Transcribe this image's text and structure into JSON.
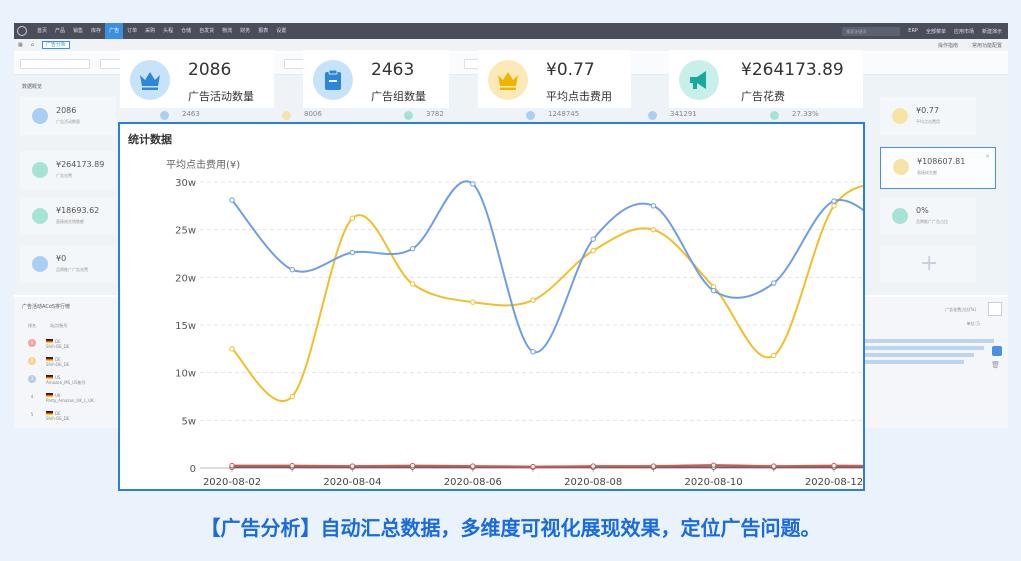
{
  "app": {
    "nav_items": [
      "首页",
      "产品",
      "销售",
      "库存",
      "广告",
      "订单",
      "采购",
      "头程",
      "仓储",
      "自发货",
      "物流",
      "财务",
      "报表",
      "设置"
    ],
    "active_nav": "广告",
    "search_placeholder": "搜索关键词",
    "nav_right": [
      "ERP",
      "全部菜单",
      "应用市场",
      "新建演示"
    ],
    "tab_label": "广告分析",
    "tab_right": [
      "操作指南",
      "常用功能配置"
    ]
  },
  "dashboard": {
    "section_title": "数据概览",
    "cards": [
      {
        "value": "2086",
        "label": "广告活动数量",
        "icon": "crown-icon",
        "color": "#a9cff5"
      },
      {
        "value": "¥264173.89",
        "label": "广告花费",
        "icon": "megaphone-icon",
        "color": "#a6e3d6"
      },
      {
        "value": "¥18693.62",
        "label": "直接成交销售额",
        "icon": "pie-icon",
        "color": "#a6e3d6"
      },
      {
        "value": "¥0",
        "label": "品牌推广广告花费",
        "icon": "cart-icon",
        "color": "#a9cff5"
      }
    ],
    "mid_values": [
      "2463",
      "8006",
      "3782",
      "1248745",
      "341291",
      "27.33%"
    ],
    "right_cards": [
      {
        "value": "¥0.77",
        "label": "平均点击费用",
        "icon": "crown-icon",
        "color": "#f7e3a6"
      },
      {
        "value": "¥108607.81",
        "label": "直接成交额",
        "icon": "doc-icon",
        "color": "#f7e3a6"
      },
      {
        "value": "0%",
        "label": "品牌推广广告占比",
        "icon": "doc-icon",
        "color": "#a6e3d6"
      }
    ],
    "ranking_title": "广告活动ACoS排行榜",
    "ranking_cols": [
      "排名",
      "站点/账号"
    ],
    "ranking_rows": [
      {
        "rank": "1",
        "site": "DE",
        "account": "Shih-DE_DE",
        "color": "#f4a3a3"
      },
      {
        "rank": "2",
        "site": "DE",
        "account": "Shih-DE_DE",
        "color": "#f7d58a"
      },
      {
        "rank": "3",
        "site": "US",
        "account": "Amazon_MS_US账号",
        "color": "#b7c9ef"
      },
      {
        "rank": "4",
        "site": "UK",
        "account": "Party_Amazon_UK_L_UK",
        "color": "#ffffff"
      },
      {
        "rank": "5",
        "site": "DE",
        "account": "Shih-DE_DE",
        "color": "#ffffff"
      }
    ],
    "ranking_right_label": "广告花费占比(%)",
    "ranking_right_label2": "单位:万"
  },
  "stat_cards": [
    {
      "value": "2086",
      "label": "广告活动数量",
      "icon": "crown-icon",
      "bg": "#c7e3fa",
      "fg": "#2f86d8"
    },
    {
      "value": "2463",
      "label": "广告组数量",
      "icon": "clipboard-icon",
      "bg": "#c7e3fa",
      "fg": "#2f86d8"
    },
    {
      "value": "¥0.77",
      "label": "平均点击费用",
      "icon": "crown-icon",
      "bg": "#fbeab8",
      "fg": "#f0b400"
    },
    {
      "value": "¥264173.89",
      "label": "广告花费",
      "icon": "megaphone-icon",
      "bg": "#c8efe9",
      "fg": "#1aa89a"
    }
  ],
  "chart_panel": {
    "title": "统计数据"
  },
  "chart_data": {
    "type": "line",
    "ylabel": "平均点击费用(¥)",
    "ylim": [
      0,
      300000
    ],
    "yticks": [
      "0",
      "5w",
      "10w",
      "15w",
      "20w",
      "25w",
      "30w"
    ],
    "x": [
      "2020-08-02",
      "2020-08-03",
      "2020-08-04",
      "2020-08-05",
      "2020-08-06",
      "2020-08-07",
      "2020-08-08",
      "2020-08-09",
      "2020-08-10",
      "2020-08-11",
      "2020-08-12",
      "2020-08-13"
    ],
    "xtick_labels": [
      "2020-08-02",
      "2020-08-04",
      "2020-08-06",
      "2020-08-08",
      "2020-08-10",
      "2020-08-12"
    ],
    "grid": true,
    "series": [
      {
        "color": "#6f9ee8",
        "values": [
          281000,
          208000,
          226000,
          230000,
          298000,
          122000,
          240000,
          275000,
          186000,
          194000,
          280000,
          243000
        ]
      },
      {
        "color": "#f2bf2a",
        "values": [
          125000,
          75000,
          262000,
          193000,
          174000,
          176000,
          228000,
          250000,
          190000,
          118000,
          275000,
          299000
        ]
      },
      {
        "color": "#d9534f",
        "values": [
          2500,
          2500,
          2000,
          2500,
          2000,
          1500,
          2000,
          2000,
          3000,
          2000,
          2500,
          2000
        ]
      },
      {
        "color": "#666666",
        "values": [
          800,
          800,
          800,
          800,
          800,
          800,
          800,
          800,
          800,
          800,
          800,
          800
        ]
      }
    ]
  },
  "caption": "【广告分析】自动汇总数据，多维度可视化展现效果，定位广告问题。"
}
